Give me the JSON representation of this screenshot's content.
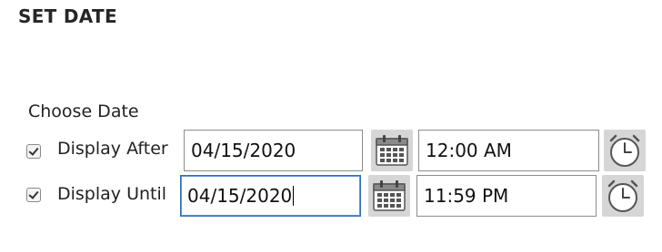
{
  "section": {
    "title": "SET DATE"
  },
  "group": {
    "label": "Choose Date"
  },
  "rows": [
    {
      "label": "Display After",
      "checked": true,
      "date": "04/15/2020",
      "time": "12:00 AM",
      "calendar_icon": "calendar-icon",
      "clock_icon": "clock-icon"
    },
    {
      "label": "Display Until",
      "checked": true,
      "date": "04/15/2020",
      "time": "11:59 PM",
      "focused": true,
      "calendar_icon": "calendar-icon",
      "clock_icon": "clock-icon"
    }
  ],
  "colors": {
    "focus_border": "#2e6fbe",
    "icon_button_bg": "#d6d6d6"
  }
}
